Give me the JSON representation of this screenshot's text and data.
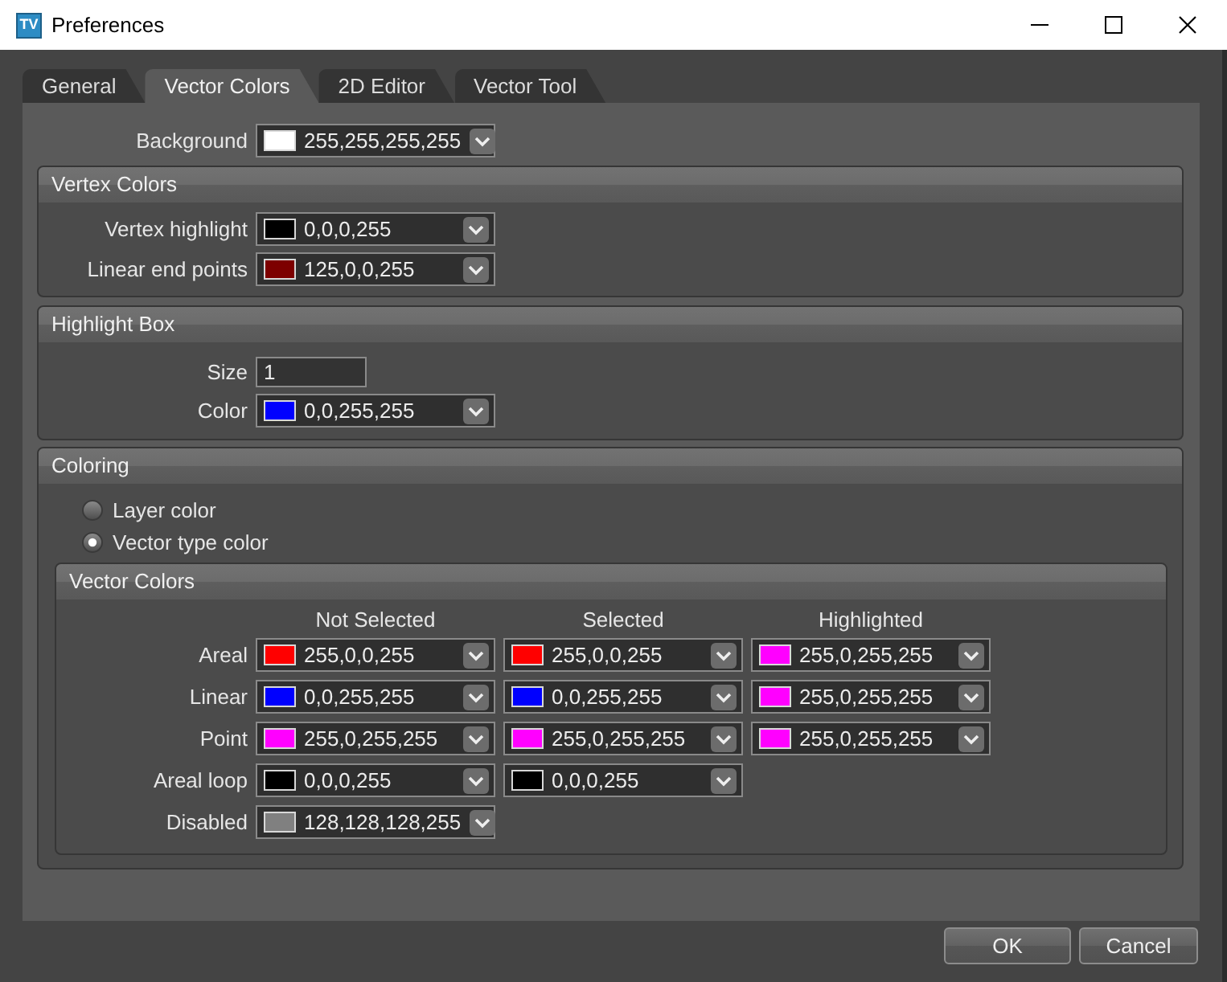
{
  "window": {
    "title": "Preferences",
    "icon_text": "TV"
  },
  "tabs": [
    {
      "label": "General",
      "selected": false
    },
    {
      "label": "Vector Colors",
      "selected": true
    },
    {
      "label": "2D Editor",
      "selected": false
    },
    {
      "label": "Vector Tool",
      "selected": false
    }
  ],
  "background": {
    "label": "Background",
    "value": "255,255,255,255",
    "color": "#ffffff"
  },
  "vertex_colors": {
    "title": "Vertex Colors",
    "fields": [
      {
        "label": "Vertex highlight",
        "value": "0,0,0,255",
        "color": "#000000"
      },
      {
        "label": "Linear end points",
        "value": "125,0,0,255",
        "color": "#7d0000"
      }
    ]
  },
  "highlight_box": {
    "title": "Highlight Box",
    "size": {
      "label": "Size",
      "value": "1"
    },
    "color": {
      "label": "Color",
      "value": "0,0,255,255",
      "color": "#0000ff"
    }
  },
  "coloring": {
    "title": "Coloring",
    "options": [
      {
        "label": "Layer color",
        "selected": false
      },
      {
        "label": "Vector type color",
        "selected": true
      }
    ],
    "vector_colors": {
      "title": "Vector Colors",
      "columns": [
        "Not Selected",
        "Selected",
        "Highlighted"
      ],
      "rows": [
        {
          "label": "Areal",
          "cells": [
            {
              "value": "255,0,0,255",
              "color": "#ff0000"
            },
            {
              "value": "255,0,0,255",
              "color": "#ff0000"
            },
            {
              "value": "255,0,255,255",
              "color": "#ff00ff"
            }
          ]
        },
        {
          "label": "Linear",
          "cells": [
            {
              "value": "0,0,255,255",
              "color": "#0000ff"
            },
            {
              "value": "0,0,255,255",
              "color": "#0000ff"
            },
            {
              "value": "255,0,255,255",
              "color": "#ff00ff"
            }
          ]
        },
        {
          "label": "Point",
          "cells": [
            {
              "value": "255,0,255,255",
              "color": "#ff00ff"
            },
            {
              "value": "255,0,255,255",
              "color": "#ff00ff"
            },
            {
              "value": "255,0,255,255",
              "color": "#ff00ff"
            }
          ]
        },
        {
          "label": "Areal loop",
          "cells": [
            {
              "value": "0,0,0,255",
              "color": "#000000"
            },
            {
              "value": "0,0,0,255",
              "color": "#000000"
            }
          ]
        },
        {
          "label": "Disabled",
          "cells": [
            {
              "value": "128,128,128,255",
              "color": "#808080"
            }
          ]
        }
      ]
    }
  },
  "buttons": [
    {
      "label": "OK"
    },
    {
      "label": "Cancel"
    }
  ]
}
